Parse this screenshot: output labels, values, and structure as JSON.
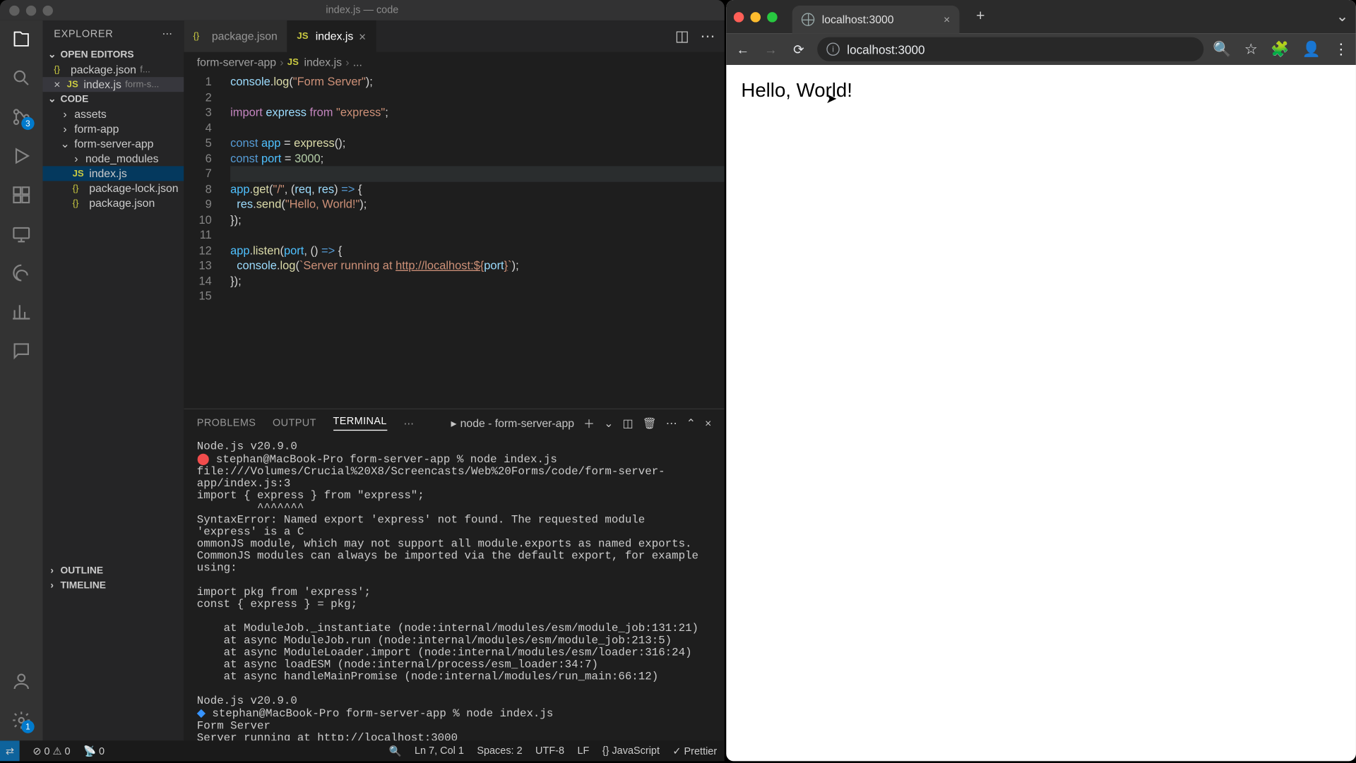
{
  "vscode": {
    "title": "index.js — code",
    "explorer_label": "EXPLORER",
    "open_editors_label": "OPEN EDITORS",
    "open_editors": [
      {
        "name": "package.json",
        "hint": "f...",
        "icon": "{}"
      },
      {
        "name": "index.js",
        "hint": "form-s...",
        "icon": "JS",
        "close": true
      }
    ],
    "workspace_label": "CODE",
    "tree": {
      "assets": "assets",
      "form_app": "form-app",
      "form_server_app": "form-server-app",
      "node_modules": "node_modules",
      "index_js": "index.js",
      "package_lock": "package-lock.json",
      "package_json": "package.json"
    },
    "outline": "OUTLINE",
    "timeline": "TIMELINE",
    "tabs": [
      {
        "label": "package.json",
        "icon": "{}"
      },
      {
        "label": "index.js",
        "icon": "JS",
        "active": true
      }
    ],
    "breadcrumb": [
      "form-server-app",
      "index.js",
      "..."
    ],
    "code_lines": [
      {
        "n": 1,
        "html": "<span class='tok-param'>console</span>.<span class='tok-fn'>log</span>(<span class='tok-str'>\"Form Server\"</span>);"
      },
      {
        "n": 2,
        "html": ""
      },
      {
        "n": 3,
        "html": "<span class='tok-kw'>import</span> <span class='tok-param'>express</span> <span class='tok-kw'>from</span> <span class='tok-str'>\"express\"</span>;"
      },
      {
        "n": 4,
        "html": ""
      },
      {
        "n": 5,
        "html": "<span class='tok-var'>const</span> <span class='tok-const'>app</span> = <span class='tok-fn'>express</span>();"
      },
      {
        "n": 6,
        "html": "<span class='tok-var'>const</span> <span class='tok-const'>port</span> = <span class='tok-num'>3000</span>;"
      },
      {
        "n": 7,
        "html": "",
        "hl": true
      },
      {
        "n": 8,
        "html": "<span class='tok-const'>app</span>.<span class='tok-fn'>get</span>(<span class='tok-str'>\"/\"</span>, (<span class='tok-param'>req</span>, <span class='tok-param'>res</span>) <span class='tok-var'>=&gt;</span> {"
      },
      {
        "n": 9,
        "html": "  <span class='tok-param'>res</span>.<span class='tok-fn'>send</span>(<span class='tok-str'>\"Hello, World!\"</span>);"
      },
      {
        "n": 10,
        "html": "});"
      },
      {
        "n": 11,
        "html": ""
      },
      {
        "n": 12,
        "html": "<span class='tok-const'>app</span>.<span class='tok-fn'>listen</span>(<span class='tok-const'>port</span>, () <span class='tok-var'>=&gt;</span> {"
      },
      {
        "n": 13,
        "html": "  <span class='tok-param'>console</span>.<span class='tok-fn'>log</span>(<span class='tok-str'>`Server running at <span class='tok-link'>http://localhost:${</span></span><span class='tok-param'>port</span><span class='tok-str'><span class='tok-link'>}</span>`</span>);"
      },
      {
        "n": 14,
        "html": "});"
      },
      {
        "n": 15,
        "html": ""
      }
    ],
    "panel": {
      "tabs": [
        "PROBLEMS",
        "OUTPUT",
        "TERMINAL"
      ],
      "term_title": "node - form-server-app",
      "content": "Node.js v20.9.0\n⬤ stephan@MacBook-Pro form-server-app % node index.js\nfile:///Volumes/Crucial%20X8/Screencasts/Web%20Forms/code/form-server-app/index.js:3\nimport { express } from \"express\";\n         ^^^^^^^\nSyntaxError: Named export 'express' not found. The requested module 'express' is a C\nommonJS module, which may not support all module.exports as named exports.\nCommonJS modules can always be imported via the default export, for example using:\n\nimport pkg from 'express';\nconst { express } = pkg;\n\n    at ModuleJob._instantiate (node:internal/modules/esm/module_job:131:21)\n    at async ModuleJob.run (node:internal/modules/esm/module_job:213:5)\n    at async ModuleLoader.import (node:internal/modules/esm/loader:316:24)\n    at async loadESM (node:internal/process/esm_loader:34:7)\n    at async handleMainPromise (node:internal/modules/run_main:66:12)\n\nNode.js v20.9.0\n◆ stephan@MacBook-Pro form-server-app % node index.js\nForm Server\nServer running at http://localhost:3000\n▯"
    },
    "status": {
      "errors": "0",
      "warnings": "0",
      "ports": "0",
      "pos": "Ln 7, Col 1",
      "spaces": "Spaces: 2",
      "enc": "UTF-8",
      "eol": "LF",
      "lang": "JavaScript",
      "prettier": "Prettier"
    },
    "scm_badge": "3",
    "settings_badge": "1"
  },
  "chrome": {
    "tab_title": "localhost:3000",
    "url": "localhost:3000",
    "page_heading": "Hello, World!"
  }
}
